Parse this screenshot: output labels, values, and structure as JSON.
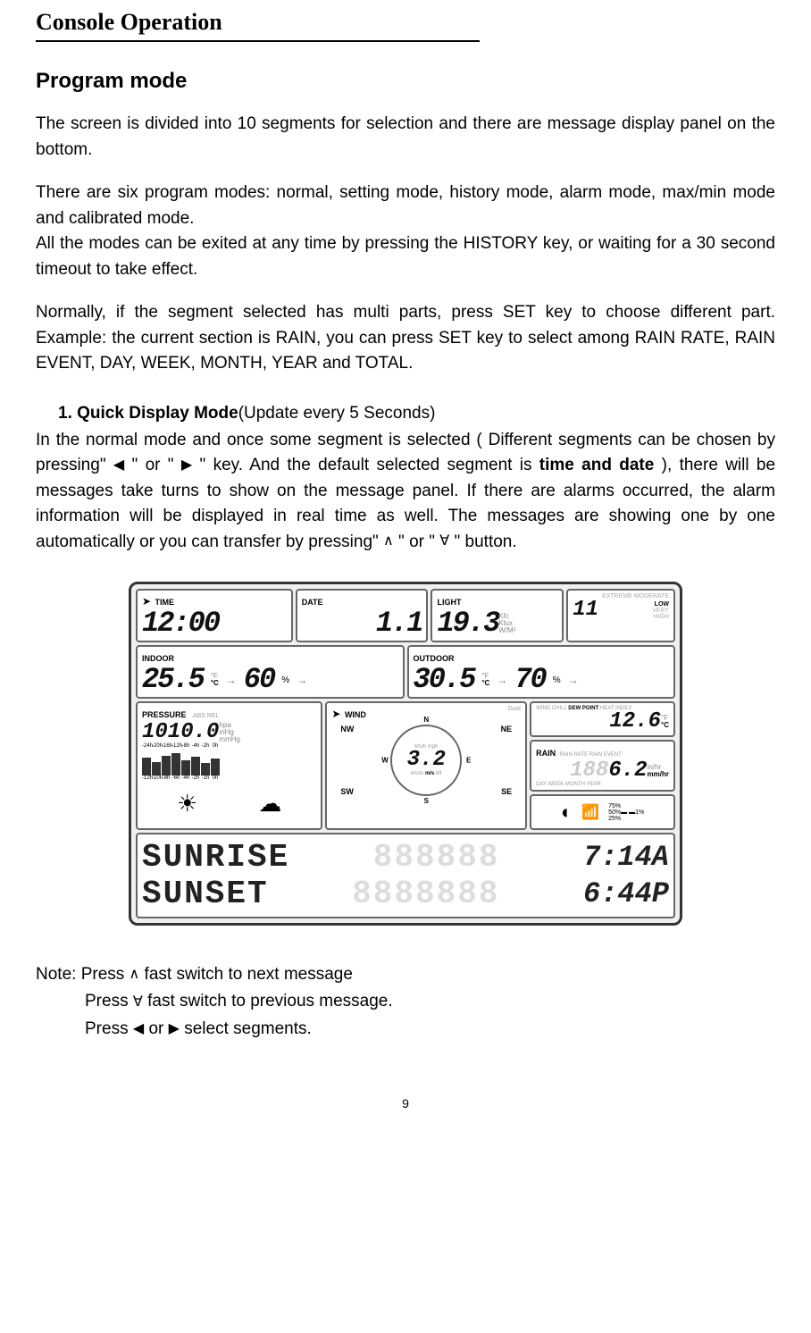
{
  "header": {
    "title": "Console Operation"
  },
  "section": {
    "title": "Program mode",
    "intro": "The screen is divided into 10 segments for selection and there are message display panel on the bottom.",
    "modes_text": "There are six program modes: normal, setting mode, history mode, alarm mode, max/min mode and calibrated mode.",
    "exit_text": "All the modes can be exited at any time by pressing the HISTORY key, or waiting for a 30 second timeout to take effect.",
    "segment_text": "Normally, if the segment selected has multi parts, press SET key to choose different part. Example: the current section is RAIN, you can press SET key to select among RAIN RATE, RAIN EVENT, DAY, WEEK, MONTH, YEAR and TOTAL."
  },
  "quick_mode": {
    "number": "1.",
    "title": "Quick Display Mode",
    "subtitle": "(Update every 5 Seconds)",
    "body_start": "In the normal mode and once some segment is selected ( Different segments can be chosen by pressing\"",
    "body_mid1": "\" or \"",
    "body_mid2": "\" key. And the default selected segment is ",
    "bold_seg": "time and date",
    "body_mid3": "), there will be messages take turns to show on the message panel. If there are alarms occurred, the alarm information will be displayed in real time as well. The messages are showing one by one automatically or you can transfer by pressing\"",
    "body_mid4": "\" or \"",
    "body_end": "\" button."
  },
  "lcd": {
    "time": {
      "label": "TIME",
      "value": "12:00"
    },
    "date": {
      "label": "DATE",
      "value": "1.1"
    },
    "light": {
      "label": "LIGHT",
      "value": "19.3",
      "units": "Kfc\nKlux\nW/M²"
    },
    "uv": {
      "labels_top": "EXTREME MODERATE",
      "value": "11",
      "levels": [
        "LOW",
        "VERY",
        "HIGH"
      ]
    },
    "indoor": {
      "label": "INDOOR",
      "temp": "25.5",
      "temp_unit": "°C",
      "hum": "60",
      "hum_unit": "%"
    },
    "outdoor": {
      "label": "OUTDOOR",
      "temp": "30.5",
      "temp_unit": "°C",
      "hum": "70",
      "hum_unit": "%"
    },
    "pressure": {
      "label": "PRESSURE",
      "sublabel": "ABS REL",
      "value": "1010.0",
      "units": "hpa\ninHg\nmmHg",
      "bar_labels_top": [
        "-24h",
        "-20h",
        "-16h",
        "-12h",
        "-8h",
        "-4h",
        "-2h",
        "0h"
      ],
      "bar_labels_bot": [
        "-12h",
        "-10h",
        "-8h",
        "-6h",
        "-4h",
        "-2h",
        "-1h",
        "0h"
      ]
    },
    "wind": {
      "label": "WIND",
      "gust": "Gust",
      "speed": "3.2",
      "directions": [
        "N",
        "NE",
        "E",
        "SE",
        "S",
        "SW",
        "W",
        "NW"
      ],
      "speed_units": "km/h mph\nknots m/s bft"
    },
    "dewpoint": {
      "label": "WIND CHILL DEW POINT HEAT INDEX",
      "value": "12.6",
      "unit": "°C"
    },
    "rain": {
      "label": "RAIN",
      "sublabel": "RAIN RATE RAIN EVENT",
      "value": "6.2",
      "unit": "mm/hr",
      "period": "DAY WEEK MONTH YEAR"
    },
    "msg": {
      "line1_label": "SUNRISE",
      "line1_time": "7:14A",
      "line2_label": "SUNSET",
      "line2_time": "6:44P"
    }
  },
  "notes": {
    "n1_a": "Note: Press ",
    "n1_b": " fast switch to next message",
    "n2_a": "Press ",
    "n2_b": " fast switch to previous message.",
    "n3_a": "Press ",
    "n3_b": " or ",
    "n3_c": " select segments."
  },
  "page_number": "9"
}
